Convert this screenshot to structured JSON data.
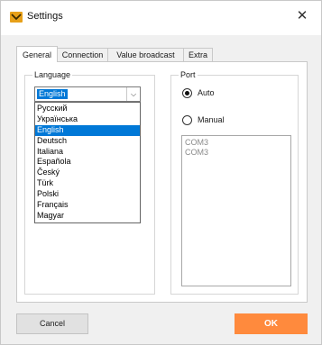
{
  "window": {
    "title": "Settings"
  },
  "tabs": [
    {
      "label": "General",
      "active": true
    },
    {
      "label": "Connection",
      "active": false
    },
    {
      "label": "Value broadcast",
      "active": false
    },
    {
      "label": "Extra",
      "active": false
    }
  ],
  "language": {
    "group_label": "Language",
    "selected": "English",
    "options": [
      "Русский",
      "Українська",
      "English",
      "Deutsch",
      "Italiana",
      "Española",
      "Český",
      "Türk",
      "Polski",
      "Français",
      "Magyar"
    ]
  },
  "port": {
    "group_label": "Port",
    "auto_label": "Auto",
    "manual_label": "Manual",
    "mode": "auto",
    "ports": [
      "COM3",
      "COM3"
    ]
  },
  "buttons": {
    "cancel": "Cancel",
    "ok": "OK"
  },
  "colors": {
    "accent": "#ff8a3d",
    "selection": "#0078d7",
    "app_icon": "#e7a019"
  }
}
